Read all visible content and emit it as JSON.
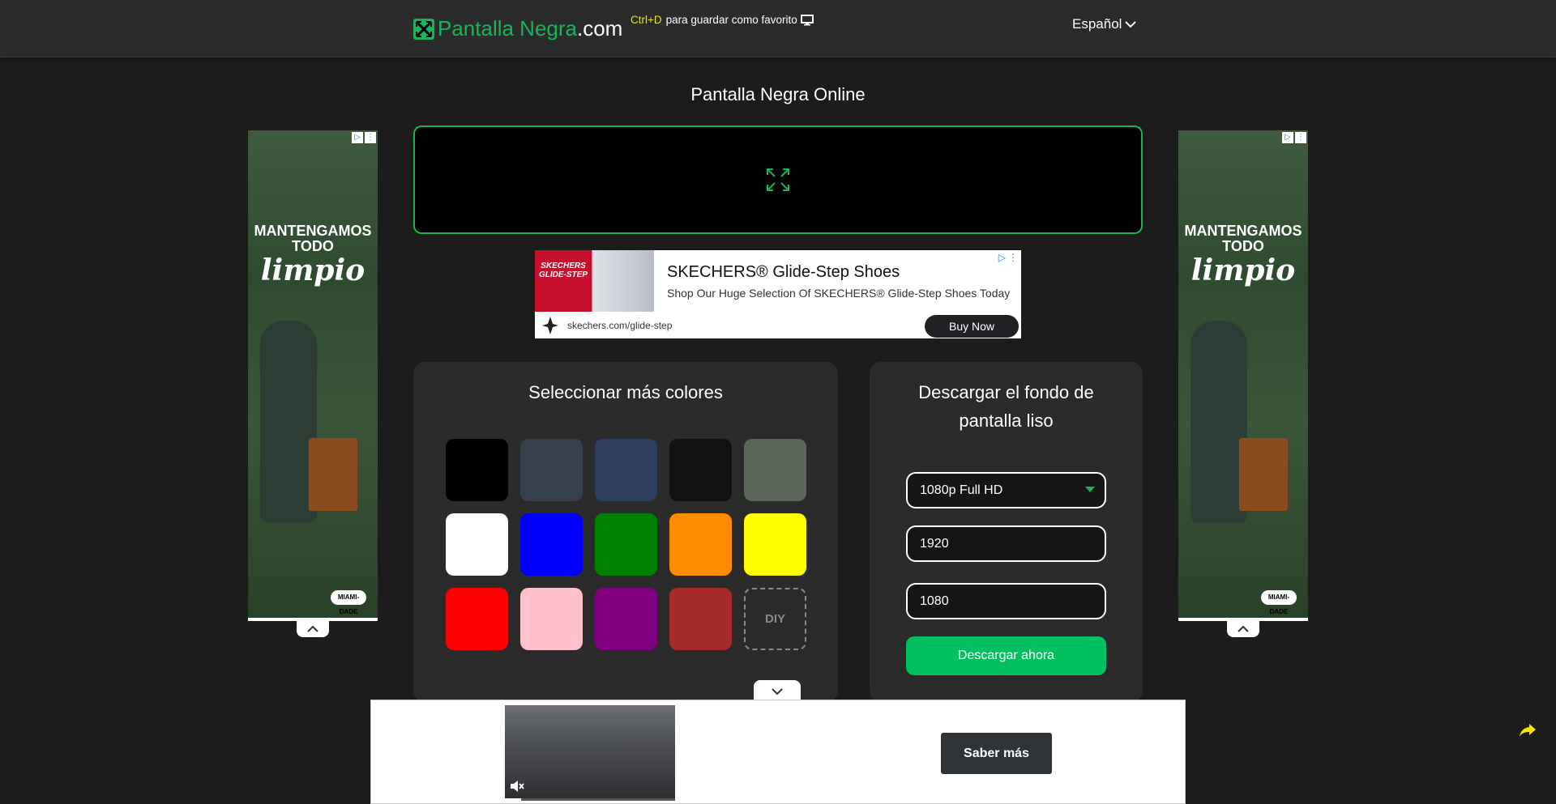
{
  "header": {
    "logo_green": "Pantalla Negra",
    "logo_white": ".com",
    "hint_key": "Ctrl+D",
    "hint_text": "para guardar como favorito",
    "language": "Español"
  },
  "main": {
    "title": "Pantalla Negra Online"
  },
  "side_ad": {
    "headline_top": "MANTENGAMOS",
    "headline_mid": "TODO",
    "headline_script": "limpio",
    "badge_logo": "MIAMI-DADE"
  },
  "banner_ad": {
    "brand_text": "SKECHERS GLIDE-STEP",
    "title": "SKECHERS® Glide-Step Shoes",
    "subtitle": "Shop Our Huge Selection Of SKECHERS® Glide-Step Shoes Today",
    "url": "skechers.com/glide-step",
    "cta": "Buy Now"
  },
  "colors_panel": {
    "title": "Seleccionar más colores",
    "swatches": [
      "#000000",
      "#37414d",
      "#2d3e5c",
      "#111111",
      "#5c665a",
      "#ffffff",
      "#0000ff",
      "#008000",
      "#ff8c00",
      "#ffff00",
      "#ff0000",
      "#ffc0cb",
      "#800080",
      "#a52a2a"
    ],
    "diy_label": "DIY"
  },
  "download_panel": {
    "title": "Descargar el fondo de pantalla liso",
    "resolution": "1080p Full HD",
    "width": "1920",
    "height": "1080",
    "button": "Descargar ahora"
  },
  "bottom_ad": {
    "cta": "Saber más"
  },
  "colors": {
    "accent": "#18b45a",
    "button_green": "#00c060",
    "hint_key": "#e6e600"
  }
}
